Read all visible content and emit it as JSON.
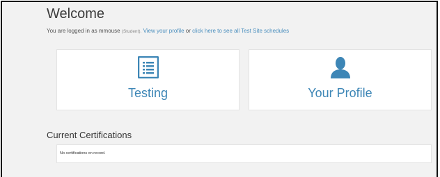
{
  "welcome": {
    "title": "Welcome",
    "login_prefix": "You are logged in as mmouse ",
    "login_role": "(Student).",
    "view_profile_link": "View your profile",
    "or_text": " or ",
    "schedules_link": "click here to see all Test Site schedules"
  },
  "tiles": [
    {
      "label": "Testing",
      "icon": "list-icon"
    },
    {
      "label": "Your Profile",
      "icon": "user-icon"
    }
  ],
  "certifications": {
    "title": "Current Certifications",
    "empty_message": "No certifications on record."
  },
  "colors": {
    "accent": "#3d86b6",
    "link": "#4b8fbe",
    "background": "#f2f2f2",
    "card": "#ffffff"
  }
}
